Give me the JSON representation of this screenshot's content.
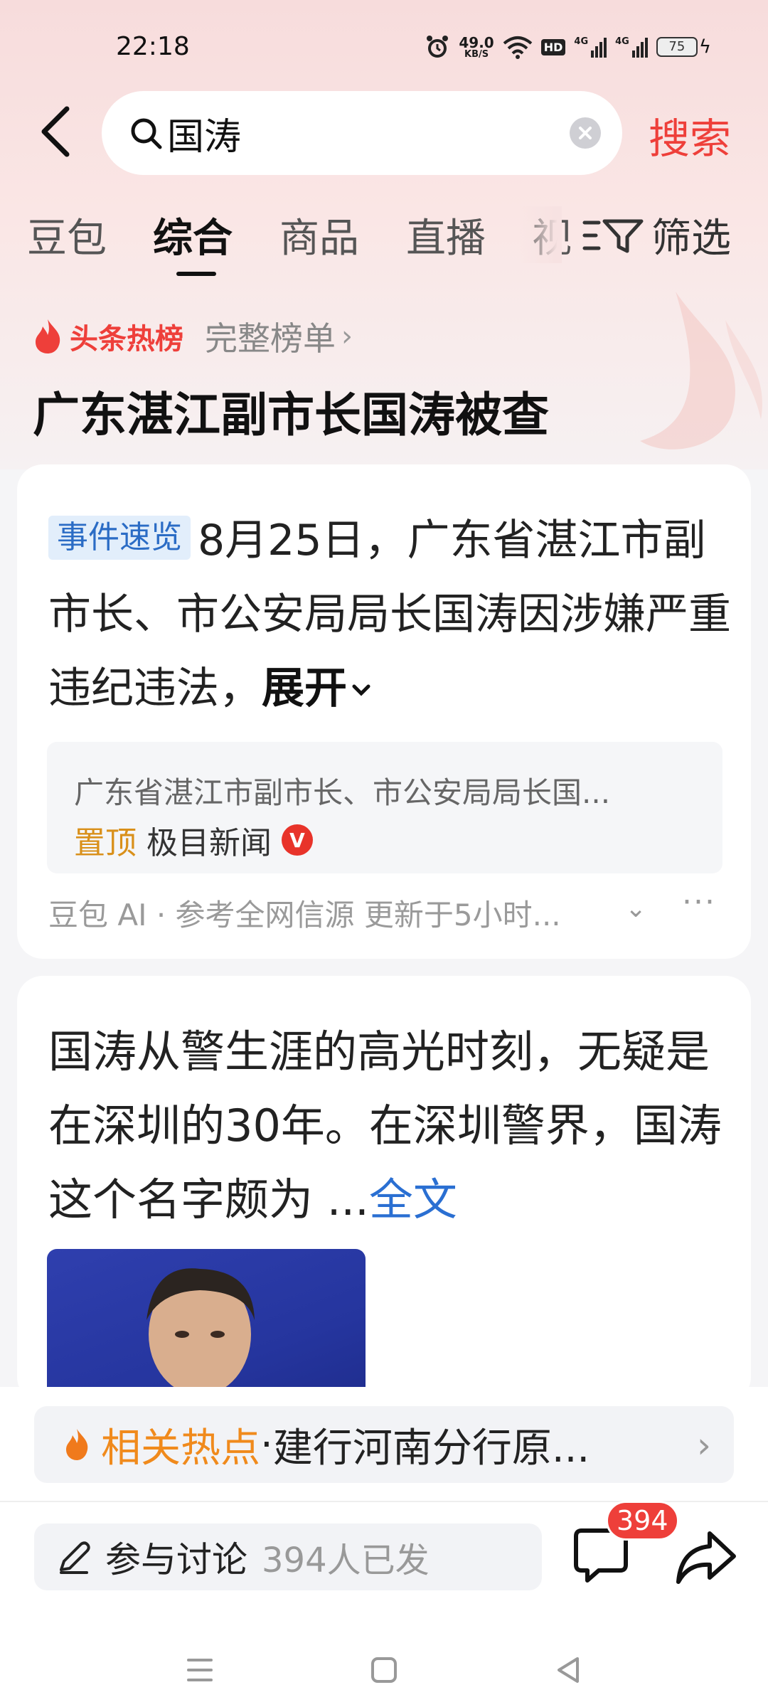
{
  "status_bar": {
    "time": "22:18",
    "net_speed_value": "49.0",
    "net_speed_unit": "KB/S",
    "hd_label": "HD",
    "signal_1_label": "4G",
    "signal_2_label": "4G",
    "battery": "75"
  },
  "search": {
    "query": "国涛",
    "button_label": "搜索"
  },
  "tabs": [
    {
      "label": "豆包"
    },
    {
      "label": "综合",
      "active": true
    },
    {
      "label": "商品"
    },
    {
      "label": "直播"
    },
    {
      "label": "视"
    }
  ],
  "filter_label": "筛选",
  "hot_list": {
    "label": "头条热榜",
    "full_list_label": "完整榜单",
    "headline": "广东湛江副市长国涛被查"
  },
  "summary_card": {
    "tag": "事件速览",
    "text": "8月25日，广东省湛江市副市长、市公安局局长国涛因涉嫌严重违纪违法，",
    "expand_label": "展开",
    "source_title": "广东省湛江市副市长、市公安局局长国...",
    "pinned_label": "置顶",
    "source_name": "极目新闻",
    "verified_badge": "V",
    "ai_footer": "豆包 AI · 参考全网信源 更新于5小时..."
  },
  "article_card": {
    "text": "国涛从警生涯的高光时刻，无疑是在深圳的30年。在深圳警界，国涛这个名字颇为 ...",
    "full_text_label": "全文"
  },
  "related": {
    "label": "相关热点",
    "separator": "·",
    "topic": "建行河南分行原..."
  },
  "discussion": {
    "label": "参与讨论",
    "count_text": "394人已发",
    "comment_count": "394"
  },
  "colors": {
    "accent_red": "#ee3f3a",
    "link_blue": "#2a6fd2",
    "tag_blue": "#2b6cc5",
    "related_orange": "#f08a1c",
    "pin_gold": "#d9901a"
  }
}
